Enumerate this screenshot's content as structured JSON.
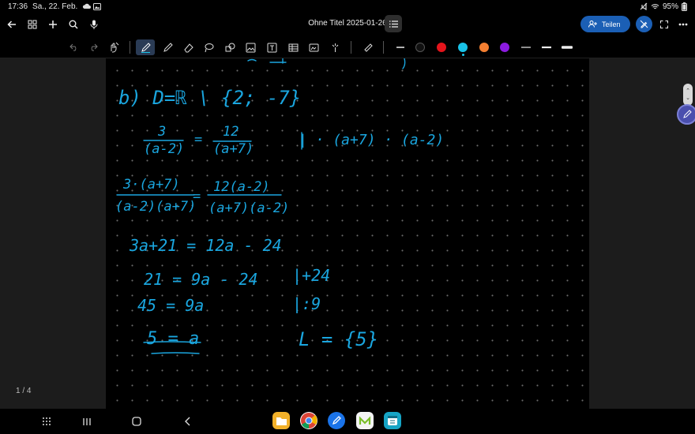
{
  "status": {
    "time": "17:36",
    "date": "Sa., 22. Feb.",
    "battery": "95%"
  },
  "appbar": {
    "title": "Ohne Titel 2025-01-26",
    "share_label": "Teilen"
  },
  "pen_colors": [
    "#ffffff",
    "#111111",
    "#e4141b",
    "#19c3e8",
    "#f47f31",
    "#8c1be0"
  ],
  "pagecount": "1 / 4",
  "note": {
    "line_b": "b) D=ℝ \\ {2; -7}",
    "eq1_left_num": "3",
    "eq1_left_den": "(a-2)",
    "eq1_right_num": "12",
    "eq1_right_den": "(a+7)",
    "eq1_op": "| · (a+7) · (a-2)",
    "eq2_left_num": "3·(a+7)",
    "eq2_left_den": "(a-2)(a+7)",
    "eq2_right_num": "12(a-2)",
    "eq2_right_den": "(a+7)(a-2)",
    "eq3": "3a+21 = 12a - 24",
    "eq4": "21 = 9a - 24",
    "eq4_op": "|+24",
    "eq5": "45 = 9a",
    "eq5_op": "|:9",
    "eq6": "5 = a",
    "solution": "L = {5}"
  }
}
